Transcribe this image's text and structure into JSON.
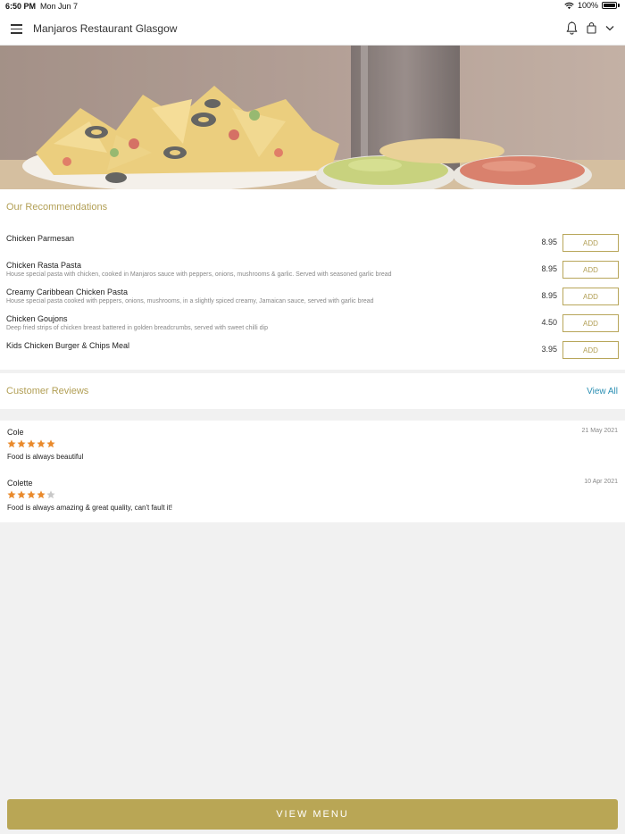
{
  "status_bar": {
    "time": "6:50 PM",
    "date": "Mon Jun 7",
    "battery": "100%"
  },
  "header": {
    "title": "Manjaros Restaurant Glasgow"
  },
  "recommendations": {
    "title": "Our Recommendations",
    "items": [
      {
        "name": "Chicken Parmesan",
        "description": "",
        "price": "8.95",
        "button": "ADD"
      },
      {
        "name": "Chicken Rasta Pasta",
        "description": "House special pasta with chicken, cooked in Manjaros sauce with peppers, onions, mushrooms & garlic. Served with seasoned garlic bread",
        "price": "8.95",
        "button": "ADD"
      },
      {
        "name": "Creamy Caribbean Chicken Pasta",
        "description": "House special pasta cooked with peppers, onions, mushrooms, in a slightly spiced creamy, Jamaican sauce, served with garlic bread",
        "price": "8.95",
        "button": "ADD"
      },
      {
        "name": "Chicken Goujons",
        "description": "Deep fried strips of chicken breast battered in golden breadcrumbs, served with sweet chilli dip",
        "price": "4.50",
        "button": "ADD"
      },
      {
        "name": "Kids Chicken Burger & Chips Meal",
        "description": "",
        "price": "3.95",
        "button": "ADD"
      }
    ]
  },
  "reviews": {
    "title": "Customer Reviews",
    "view_all": "View All",
    "items": [
      {
        "name": "Cole",
        "date": "21 May 2021",
        "rating": 5,
        "text": "Food is always beautiful"
      },
      {
        "name": "Colette",
        "date": "10 Apr 2021",
        "rating": 4,
        "text": "Food is always amazing & great quality, can't fault it!"
      }
    ]
  },
  "footer": {
    "button": "VIEW MENU"
  },
  "colors": {
    "accent": "#b9a655",
    "link": "#2b8fb3",
    "star_filled": "#e98a2c",
    "star_empty": "#c8c8c8"
  },
  "icons": [
    "menu-icon",
    "bell-icon",
    "bag-icon",
    "chevron-down-icon",
    "wifi-icon",
    "battery-icon",
    "star-icon"
  ]
}
